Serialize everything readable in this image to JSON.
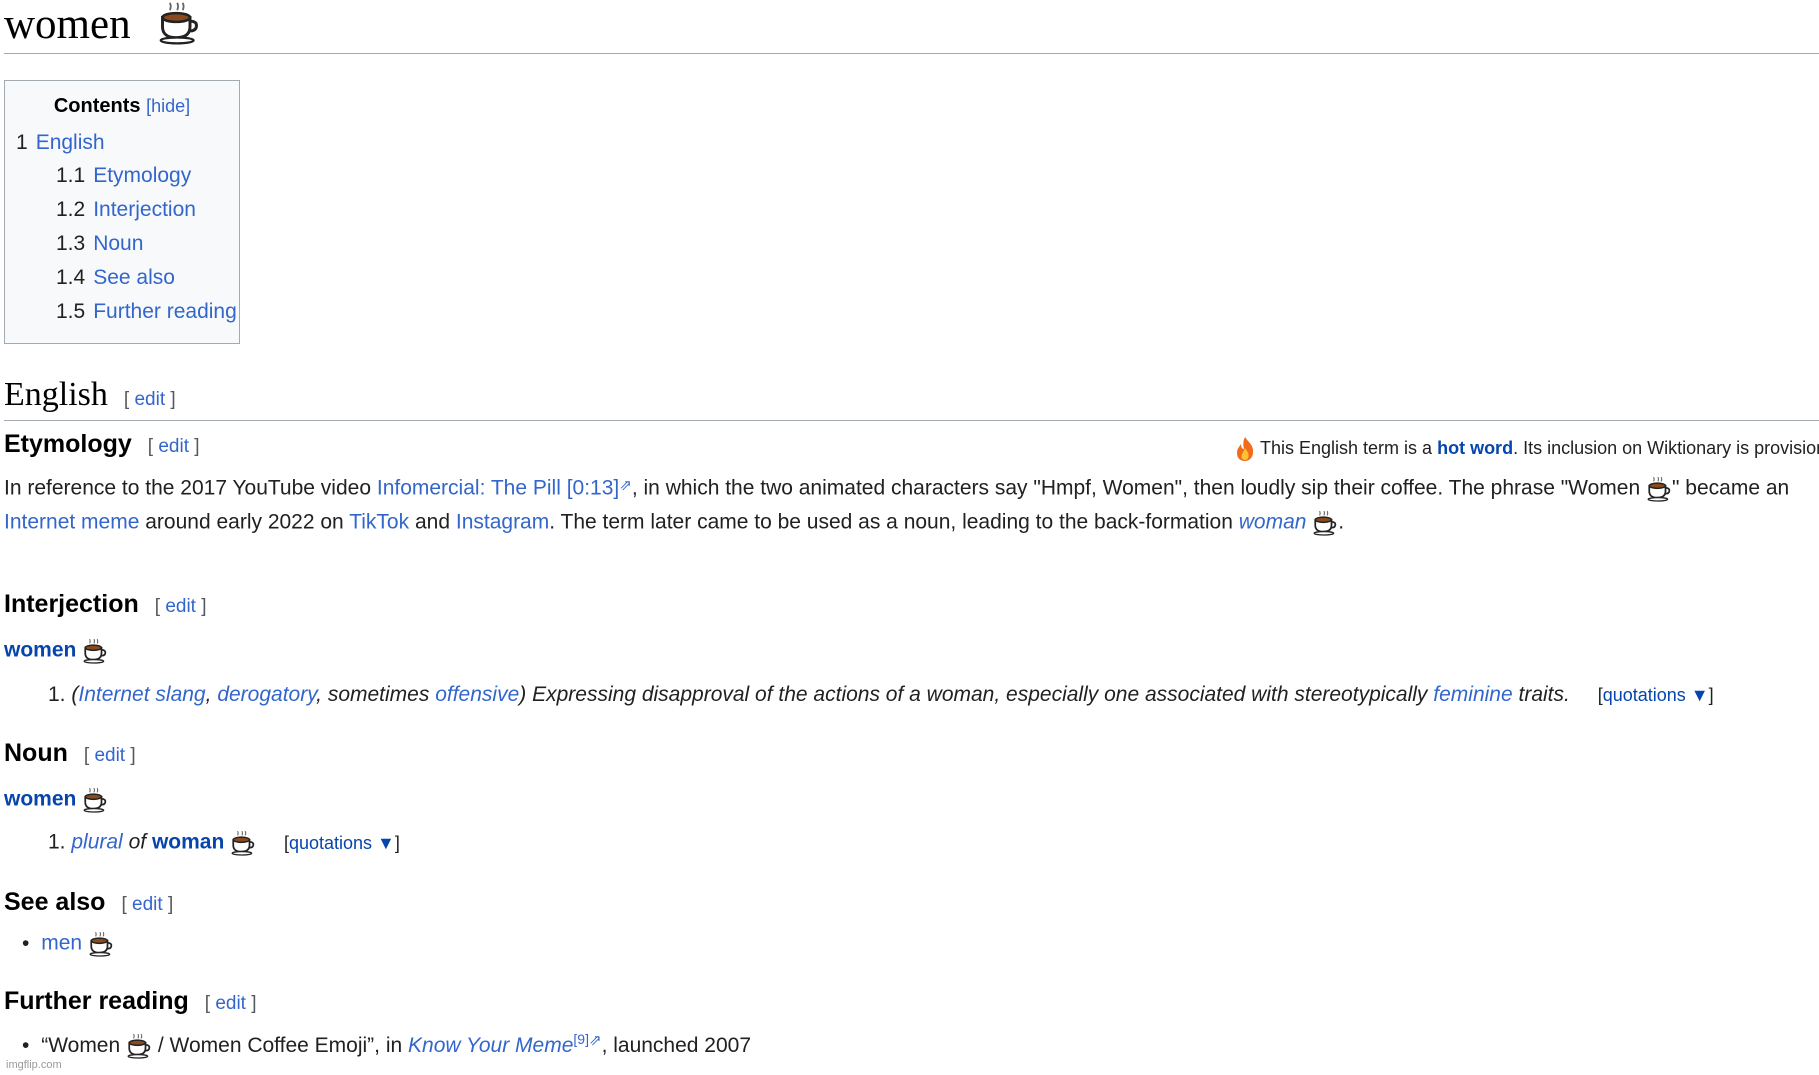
{
  "title": "women",
  "toc": {
    "title": "Contents",
    "toggle": "[hide]",
    "items": [
      {
        "num": "1",
        "label": "English"
      },
      {
        "num": "1.1",
        "label": "Etymology"
      },
      {
        "num": "1.2",
        "label": "Interjection"
      },
      {
        "num": "1.3",
        "label": "Noun"
      },
      {
        "num": "1.4",
        "label": "See also"
      },
      {
        "num": "1.5",
        "label": "Further reading"
      }
    ]
  },
  "edit": {
    "open": "[",
    "label": "edit",
    "close": "]"
  },
  "english": {
    "heading": "English"
  },
  "hot_word": {
    "pre": "This English term is a",
    "link": "hot word",
    "post": ". Its inclusion on Wiktionary is provisiona"
  },
  "etymology": {
    "heading": "Etymology",
    "t1": "In reference to the 2017 YouTube video",
    "video_link": "Infomercial: The Pill [0:13]",
    "t2": ", in which the two animated characters say \"Hmpf, Women\", then loudly sip their coffee. The phrase \"Women",
    "t3": "\" became an",
    "meme_link": "Internet meme",
    "t4": "around early 2022 on",
    "tiktok": "TikTok",
    "and": "and",
    "instagram": "Instagram",
    "t5": ". The term later came to be used as a noun, leading to the back-formation",
    "woman_link": "woman",
    "t6": "."
  },
  "interjection": {
    "heading": "Interjection",
    "headword": "women",
    "def_num": "1.",
    "open_paren": "(",
    "label1": "Internet slang",
    "comma": ",",
    "label2": "derogatory",
    "label3_pre": ", sometimes",
    "label3": "offensive",
    "close_paren": ")",
    "def_text": "Expressing disapproval of the actions of a woman, especially one associated with stereotypically",
    "feminine": "feminine",
    "def_end": "traits.",
    "quotations": "quotations ▼"
  },
  "noun": {
    "heading": "Noun",
    "headword": "women",
    "def_num": "1.",
    "plural": "plural",
    "of": "of",
    "woman": "woman",
    "quotations": "quotations ▼"
  },
  "see_also": {
    "heading": "See also",
    "item": "men"
  },
  "further_reading": {
    "heading": "Further reading",
    "q1": "“Women",
    "q2": "/ Women Coffee Emoji”, in",
    "kym": "Know Your Meme",
    "ref": "[9]",
    "tail": ", launched 2007"
  },
  "watermark": "imgflip.com",
  "icons": {
    "cup": "coffee-cup-icon",
    "fire": "fire-icon",
    "external": "external-link-icon"
  }
}
